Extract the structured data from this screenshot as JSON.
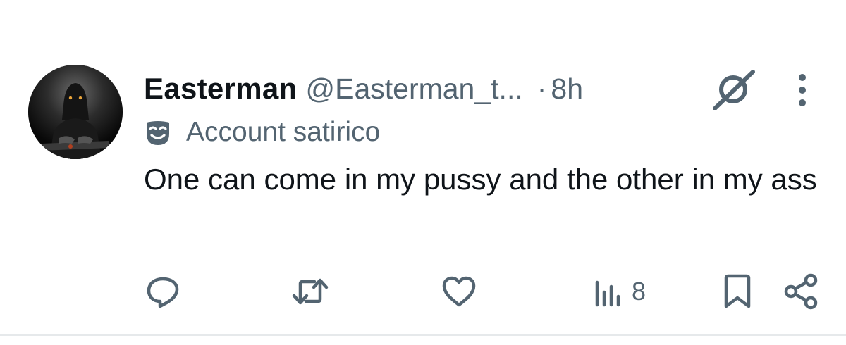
{
  "tweet": {
    "display_name": "Easterman",
    "handle": "@Easterman_t...",
    "separator": "·",
    "time": "8h",
    "label": "Account satirico",
    "text": "One can come in my pussy and the other in my ass"
  },
  "icons": {
    "avatar": "avatar-image",
    "grok": "grok-icon",
    "more": "more-vertical-icon",
    "label": "mask-icon",
    "reply": "reply-icon",
    "retweet": "retweet-icon",
    "like": "heart-icon",
    "views": "views-icon",
    "bookmark": "bookmark-icon",
    "share": "share-icon"
  },
  "actions": {
    "views_count": "8"
  },
  "colors": {
    "text_primary": "#0f1419",
    "text_secondary": "#536471",
    "divider": "#e6e9eb"
  }
}
